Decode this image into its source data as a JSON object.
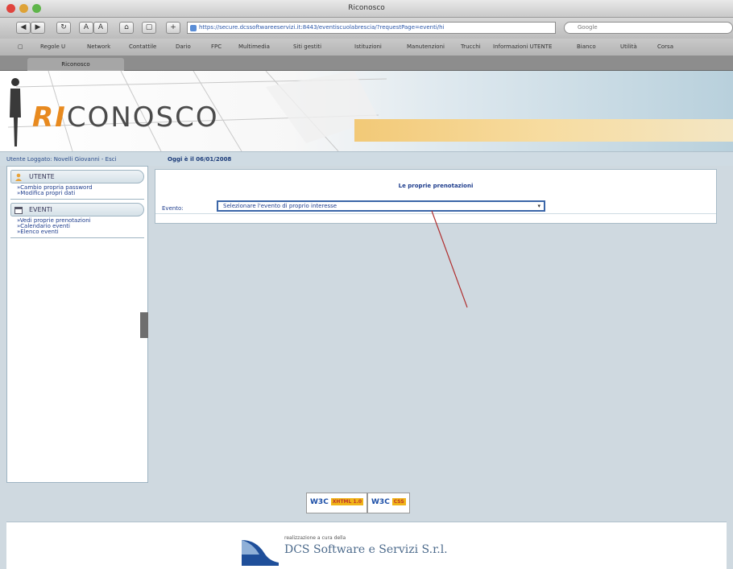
{
  "window": {
    "title": "Riconosco"
  },
  "toolbar": {
    "url": "https://secure.dcssoftwareeservizi.it:8443/eventiscuolabrescia/?requestPage=eventi/hi",
    "search_placeholder": "Google"
  },
  "bookmarks": [
    "Regole U",
    "Network",
    "Contattile",
    "Dario",
    "FPC",
    "Multimedia",
    "Siti gestiti",
    "Istituzioni",
    "Manutenzioni",
    "Trucchi",
    "Informazioni UTENTE",
    "Bianco",
    "Utilità",
    "Corsa"
  ],
  "tab": {
    "label": "Riconosco"
  },
  "banner": {
    "logo_prefix": "RI",
    "logo_suffix": "CONOSCO"
  },
  "infobar": {
    "user": "Utente Loggato: Novelli Giovanni - Esci",
    "date": "Oggi è il 06/01/2008"
  },
  "sidebar": {
    "sections": [
      {
        "title": "UTENTE",
        "icon": "user-icon",
        "links": [
          "Cambio propria password",
          "Modifica propri dati"
        ]
      },
      {
        "title": "EVENTI",
        "icon": "calendar-icon",
        "links": [
          "Vedi proprie prenotazioni",
          "Calendario eventi",
          "Elenco eventi"
        ]
      }
    ]
  },
  "main": {
    "title": "Le proprie prenotazioni",
    "label": "Evento:",
    "select_value": "Selezionare l'evento di proprio interesse"
  },
  "footer": {
    "badges": [
      {
        "label": "W3C",
        "tag": "XHTML 1.0"
      },
      {
        "label": "W3C",
        "tag": "CSS"
      }
    ],
    "credit_small": "realizzazione a cura della",
    "company": "DCS Software e Servizi S.r.l."
  },
  "colors": {
    "page_bg": "#cfd9e0",
    "link": "#1d3c8c",
    "logo_accent": "#e88a1f",
    "annotation_line": "#b03030"
  }
}
